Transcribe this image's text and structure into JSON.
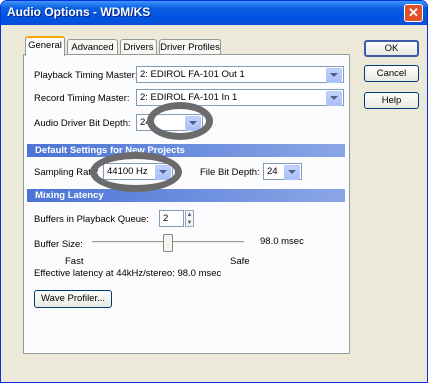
{
  "window": {
    "title": "Audio Options - WDM/KS",
    "close_symbol": "✕"
  },
  "tabs": [
    {
      "label": "General",
      "active": true
    },
    {
      "label": "Advanced"
    },
    {
      "label": "Drivers"
    },
    {
      "label": "Driver Profiles"
    }
  ],
  "buttons": {
    "ok": "OK",
    "cancel": "Cancel",
    "help": "Help",
    "wave_profiler": "Wave Profiler..."
  },
  "general": {
    "playback_label": "Playback Timing Master:",
    "playback_value": "2: EDIROL FA-101 Out 1",
    "record_label": "Record Timing Master:",
    "record_value": "2: EDIROL FA-101 In 1",
    "driver_bit_depth_label": "Audio Driver Bit Depth:",
    "driver_bit_depth_value": "24"
  },
  "default_settings": {
    "header": "Default Settings for New Projects",
    "sampling_rate_label": "Sampling Rate:",
    "sampling_rate_value": "44100 Hz",
    "file_bit_depth_label": "File Bit Depth:",
    "file_bit_depth_value": "24"
  },
  "mixing_latency": {
    "header": "Mixing Latency",
    "buffers_label": "Buffers in Playback Queue:",
    "buffers_value": "2",
    "buffer_size_label": "Buffer Size:",
    "buffer_size_value": "98.0 msec",
    "slider_level": 0.5,
    "fast_label": "Fast",
    "safe_label": "Safe",
    "effective_latency": "Effective latency at 44kHz/stereo: 98.0 msec"
  },
  "colors": {
    "title_bar": "#0054e3",
    "section_header": "#4a73d5",
    "highlight_ring": "#6b6b6b",
    "close_button": "#e0502b"
  }
}
